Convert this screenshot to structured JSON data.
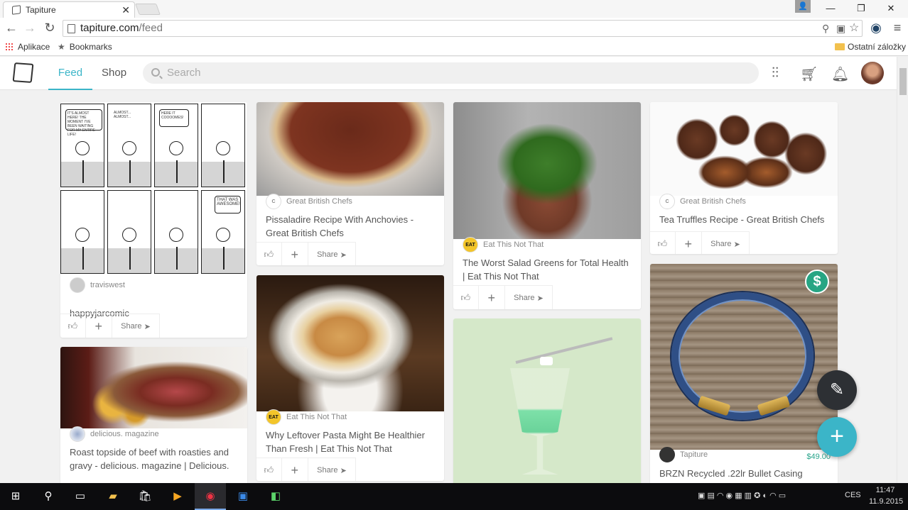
{
  "browser": {
    "tab_title": "Tapiture",
    "url_domain": "tapiture.com",
    "url_path": "/feed",
    "bookmarks": {
      "apps": "Aplikace",
      "bookmarks": "Bookmarks",
      "other": "Ostatní záložky"
    }
  },
  "site": {
    "nav_feed": "Feed",
    "nav_shop": "Shop",
    "search_placeholder": "Search",
    "accent": "#3bb5c8"
  },
  "cards": {
    "happyjar": {
      "source": "traviswest",
      "title": "happyjarcomic",
      "share": "Share"
    },
    "beef": {
      "source": "delicious. magazine",
      "title": "Roast topside of beef with roasties and gravy - delicious. magazine | Delicious."
    },
    "pissaladire": {
      "source": "Great British Chefs",
      "title": "Pissaladire Recipe With Anchovies - Great British Chefs",
      "share": "Share"
    },
    "pasta": {
      "source": "Eat This Not That",
      "title": "Why Leftover Pasta Might Be Healthier Than Fresh | Eat This Not That",
      "share": "Share"
    },
    "greens": {
      "source": "Eat This Not That",
      "title": "The Worst Salad Greens for Total Health | Eat This Not That",
      "share": "Share"
    },
    "truffles": {
      "source": "Great British Chefs",
      "title": "Tea Truffles Recipe - Great British Chefs",
      "share": "Share"
    },
    "bracelet": {
      "source": "Tapiture",
      "price": "$49.00",
      "title": "BRZN Recycled .22lr Bullet Casing",
      "badge": "$"
    }
  },
  "comic": {
    "bubble1": "IT'S ALMOST HERE! THE MOMENT I'VE BEEN WAITING FOR MY ENTIRE LIFE!",
    "bubble2": "ALMOST... ALMOST...",
    "bubble3": "HERE IT COOOOMES!",
    "bubble8": "THAT WAS AWESOME!"
  },
  "taskbar": {
    "lang": "CES",
    "time": "11:47",
    "date": "11.9.2015"
  }
}
